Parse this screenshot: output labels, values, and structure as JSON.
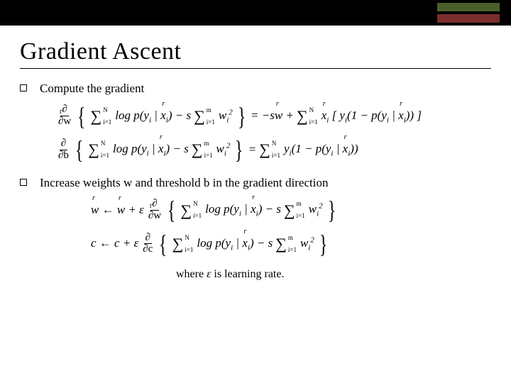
{
  "title": "Gradient Ascent",
  "bullets": {
    "b1": "Compute the gradient",
    "b2": "Increase weights w and threshold b in the gradient direction"
  },
  "eq": {
    "partial": "∂",
    "dw": "∂w",
    "db": "∂b",
    "dc": "∂c",
    "sum_i_lo": "i=1",
    "sum_i_up_N": "N",
    "sum_i_up_m": "m",
    "logp": "log p(y",
    "p": "p(y",
    "y": "y",
    "x": "x",
    "w": "w",
    "b": "b",
    "c": "c",
    "s": "s",
    "eps": "ε",
    "arrow": "←",
    "plus": "+",
    "minus": "−",
    "eq": "=",
    "one": "1",
    "sq": "2",
    "sw": "sw",
    "open": "(",
    "close": ")",
    "bracko": "[",
    "brackc": "]",
    "bar": "|",
    "caption": "where ε is learning rate."
  }
}
